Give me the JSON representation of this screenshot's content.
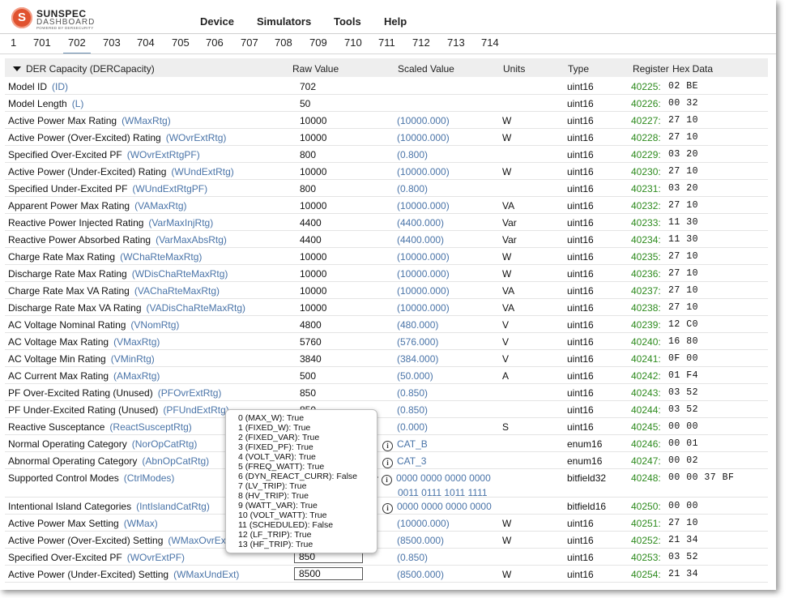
{
  "header": {
    "logo_line1": "SUNSPEC",
    "logo_line2": "DASHBOARD",
    "logo_line3": "POWERED BY DERSECURITY",
    "logo_letter": "S",
    "menu": [
      "Device",
      "Simulators",
      "Tools",
      "Help"
    ]
  },
  "tabs": [
    "1",
    "701",
    "702",
    "703",
    "704",
    "705",
    "706",
    "707",
    "708",
    "709",
    "710",
    "711",
    "712",
    "713",
    "714"
  ],
  "active_tab": "702",
  "table": {
    "title": "DER Capacity (DERCapacity)",
    "columns": [
      "Raw Value",
      "Scaled Value",
      "Units",
      "Type",
      "Register",
      "Hex Data"
    ],
    "rows": [
      {
        "name": "Model ID",
        "pt": "(ID)",
        "raw": "702",
        "scaled": "",
        "units": "",
        "type": "uint16",
        "reg": "40225:",
        "hex": "02 BE"
      },
      {
        "name": "Model Length",
        "pt": "(L)",
        "raw": "50",
        "scaled": "",
        "units": "",
        "type": "uint16",
        "reg": "40226:",
        "hex": "00 32"
      },
      {
        "name": "Active Power Max Rating",
        "pt": "(WMaxRtg)",
        "raw": "10000",
        "scaled": "(10000.000)",
        "units": "W",
        "type": "uint16",
        "reg": "40227:",
        "hex": "27 10"
      },
      {
        "name": "Active Power (Over-Excited) Rating",
        "pt": "(WOvrExtRtg)",
        "raw": "10000",
        "scaled": "(10000.000)",
        "units": "W",
        "type": "uint16",
        "reg": "40228:",
        "hex": "27 10"
      },
      {
        "name": "Specified Over-Excited PF",
        "pt": "(WOvrExtRtgPF)",
        "raw": "800",
        "scaled": "(0.800)",
        "units": "",
        "type": "uint16",
        "reg": "40229:",
        "hex": "03 20"
      },
      {
        "name": "Active Power (Under-Excited) Rating",
        "pt": "(WUndExtRtg)",
        "raw": "10000",
        "scaled": "(10000.000)",
        "units": "W",
        "type": "uint16",
        "reg": "40230:",
        "hex": "27 10"
      },
      {
        "name": "Specified Under-Excited PF",
        "pt": "(WUndExtRtgPF)",
        "raw": "800",
        "scaled": "(0.800)",
        "units": "",
        "type": "uint16",
        "reg": "40231:",
        "hex": "03 20"
      },
      {
        "name": "Apparent Power Max Rating",
        "pt": "(VAMaxRtg)",
        "raw": "10000",
        "scaled": "(10000.000)",
        "units": "VA",
        "type": "uint16",
        "reg": "40232:",
        "hex": "27 10"
      },
      {
        "name": "Reactive Power Injected Rating",
        "pt": "(VarMaxInjRtg)",
        "raw": "4400",
        "scaled": "(4400.000)",
        "units": "Var",
        "type": "uint16",
        "reg": "40233:",
        "hex": "11 30"
      },
      {
        "name": "Reactive Power Absorbed Rating",
        "pt": "(VarMaxAbsRtg)",
        "raw": "4400",
        "scaled": "(4400.000)",
        "units": "Var",
        "type": "uint16",
        "reg": "40234:",
        "hex": "11 30"
      },
      {
        "name": "Charge Rate Max Rating",
        "pt": "(WChaRteMaxRtg)",
        "raw": "10000",
        "scaled": "(10000.000)",
        "units": "W",
        "type": "uint16",
        "reg": "40235:",
        "hex": "27 10"
      },
      {
        "name": "Discharge Rate Max Rating",
        "pt": "(WDisChaRteMaxRtg)",
        "raw": "10000",
        "scaled": "(10000.000)",
        "units": "W",
        "type": "uint16",
        "reg": "40236:",
        "hex": "27 10"
      },
      {
        "name": "Charge Rate Max VA Rating",
        "pt": "(VAChaRteMaxRtg)",
        "raw": "10000",
        "scaled": "(10000.000)",
        "units": "VA",
        "type": "uint16",
        "reg": "40237:",
        "hex": "27 10"
      },
      {
        "name": "Discharge Rate Max VA Rating",
        "pt": "(VADisChaRteMaxRtg)",
        "raw": "10000",
        "scaled": "(10000.000)",
        "units": "VA",
        "type": "uint16",
        "reg": "40238:",
        "hex": "27 10"
      },
      {
        "name": "AC Voltage Nominal Rating",
        "pt": "(VNomRtg)",
        "raw": "4800",
        "scaled": "(480.000)",
        "units": "V",
        "type": "uint16",
        "reg": "40239:",
        "hex": "12 C0"
      },
      {
        "name": "AC Voltage Max Rating",
        "pt": "(VMaxRtg)",
        "raw": "5760",
        "scaled": "(576.000)",
        "units": "V",
        "type": "uint16",
        "reg": "40240:",
        "hex": "16 80"
      },
      {
        "name": "AC Voltage Min Rating",
        "pt": "(VMinRtg)",
        "raw": "3840",
        "scaled": "(384.000)",
        "units": "V",
        "type": "uint16",
        "reg": "40241:",
        "hex": "0F 00"
      },
      {
        "name": "AC Current Max Rating",
        "pt": "(AMaxRtg)",
        "raw": "500",
        "scaled": "(50.000)",
        "units": "A",
        "type": "uint16",
        "reg": "40242:",
        "hex": "01 F4"
      },
      {
        "name": "PF Over-Excited Rating (Unused)",
        "pt": "(PFOvrExtRtg)",
        "raw": "850",
        "scaled": "(0.850)",
        "units": "",
        "type": "uint16",
        "reg": "40243:",
        "hex": "03 52"
      },
      {
        "name": "PF Under-Excited Rating (Unused)",
        "pt": "(PFUndExtRtg)",
        "raw": "850",
        "scaled": "(0.850)",
        "units": "",
        "type": "uint16",
        "reg": "40244:",
        "hex": "03 52"
      },
      {
        "name": "Reactive Susceptance",
        "pt": "(ReactSusceptRtg)",
        "raw": "",
        "scaled": "(0.000)",
        "units": "S",
        "type": "uint16",
        "reg": "40245:",
        "hex": "00 00"
      },
      {
        "name": "Normal Operating Category",
        "pt": "(NorOpCatRtg)",
        "raw": "",
        "scaled": "CAT_B",
        "units": "",
        "type": "enum16",
        "reg": "40246:",
        "hex": "00 01",
        "info": true
      },
      {
        "name": "Abnormal Operating Category",
        "pt": "(AbnOpCatRtg)",
        "raw": "",
        "scaled": "CAT_3",
        "units": "",
        "type": "enum16",
        "reg": "40247:",
        "hex": "00 02",
        "info": true
      },
      {
        "name": "Supported Control Modes",
        "pt": "(CtrlModes)",
        "raw": "",
        "scaled": "0000 0000 0000 0000",
        "scaled2": "0011 0111 1011 1111",
        "units": "",
        "type": "bitfield32",
        "reg": "40248:",
        "hex": "00 00 37 BF",
        "info": true,
        "tall": true
      },
      {
        "name": "Intentional Island Categories",
        "pt": "(IntIslandCatRtg)",
        "raw": "",
        "scaled": "0000 0000 0000 0000",
        "units": "",
        "type": "bitfield16",
        "reg": "40250:",
        "hex": "00 00",
        "info": true
      },
      {
        "name": "Active Power Max Setting",
        "pt": "(WMax)",
        "raw": "",
        "scaled": "(10000.000)",
        "units": "W",
        "type": "uint16",
        "reg": "40251:",
        "hex": "27 10"
      },
      {
        "name": "Active Power (Over-Excited) Setting",
        "pt": "(WMaxOvrExt)",
        "raw": "",
        "scaled": "(8500.000)",
        "units": "W",
        "type": "uint16",
        "reg": "40252:",
        "hex": "21 34"
      },
      {
        "name": "Specified Over-Excited PF",
        "pt": "(WOvrExtPF)",
        "raw": "850",
        "scaled": "(0.850)",
        "units": "",
        "type": "uint16",
        "reg": "40253:",
        "hex": "03 52",
        "input": true
      },
      {
        "name": "Active Power (Under-Excited) Setting",
        "pt": "(WMaxUndExt)",
        "raw": "8500",
        "scaled": "(8500.000)",
        "units": "W",
        "type": "uint16",
        "reg": "40254:",
        "hex": "21 34",
        "input": true
      }
    ]
  },
  "popup": {
    "items": [
      "0 (MAX_W): True",
      "1 (FIXED_W): True",
      "2 (FIXED_VAR): True",
      "3 (FIXED_PF): True",
      "4 (VOLT_VAR): True",
      "5 (FREQ_WATT): True",
      "6 (DYN_REACT_CURR): False",
      "7 (LV_TRIP): True",
      "8 (HV_TRIP): True",
      "9 (WATT_VAR): True",
      "10 (VOLT_WATT): True",
      "11 (SCHEDULED): False",
      "12 (LF_TRIP): True",
      "13 (HF_TRIP): True"
    ]
  },
  "colors": {
    "point_name": "#4a74a8",
    "register": "#2e8b1e",
    "header_bg": "#eeeeee",
    "logo": "#e0522f"
  }
}
